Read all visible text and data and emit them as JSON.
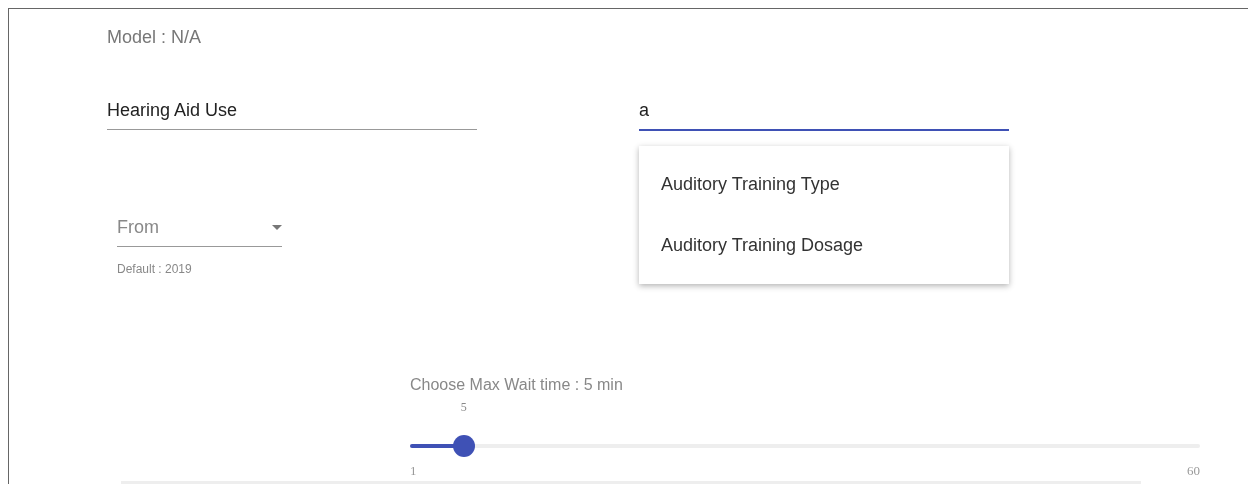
{
  "model_label": "Model : N/A",
  "fields": [
    {
      "value": "Hearing Aid Use",
      "focused": false
    },
    {
      "value": "a",
      "focused": true
    }
  ],
  "suggestions": [
    {
      "label": "Auditory Training Type"
    },
    {
      "label": "Auditory Training Dosage"
    }
  ],
  "from_select": {
    "placeholder": "From",
    "helper": "Default : 2019"
  },
  "slider": {
    "label": "Choose Max Wait time : 5 min",
    "value_label": "5",
    "level": 0.068,
    "min_label": "1",
    "max_label": "60"
  }
}
